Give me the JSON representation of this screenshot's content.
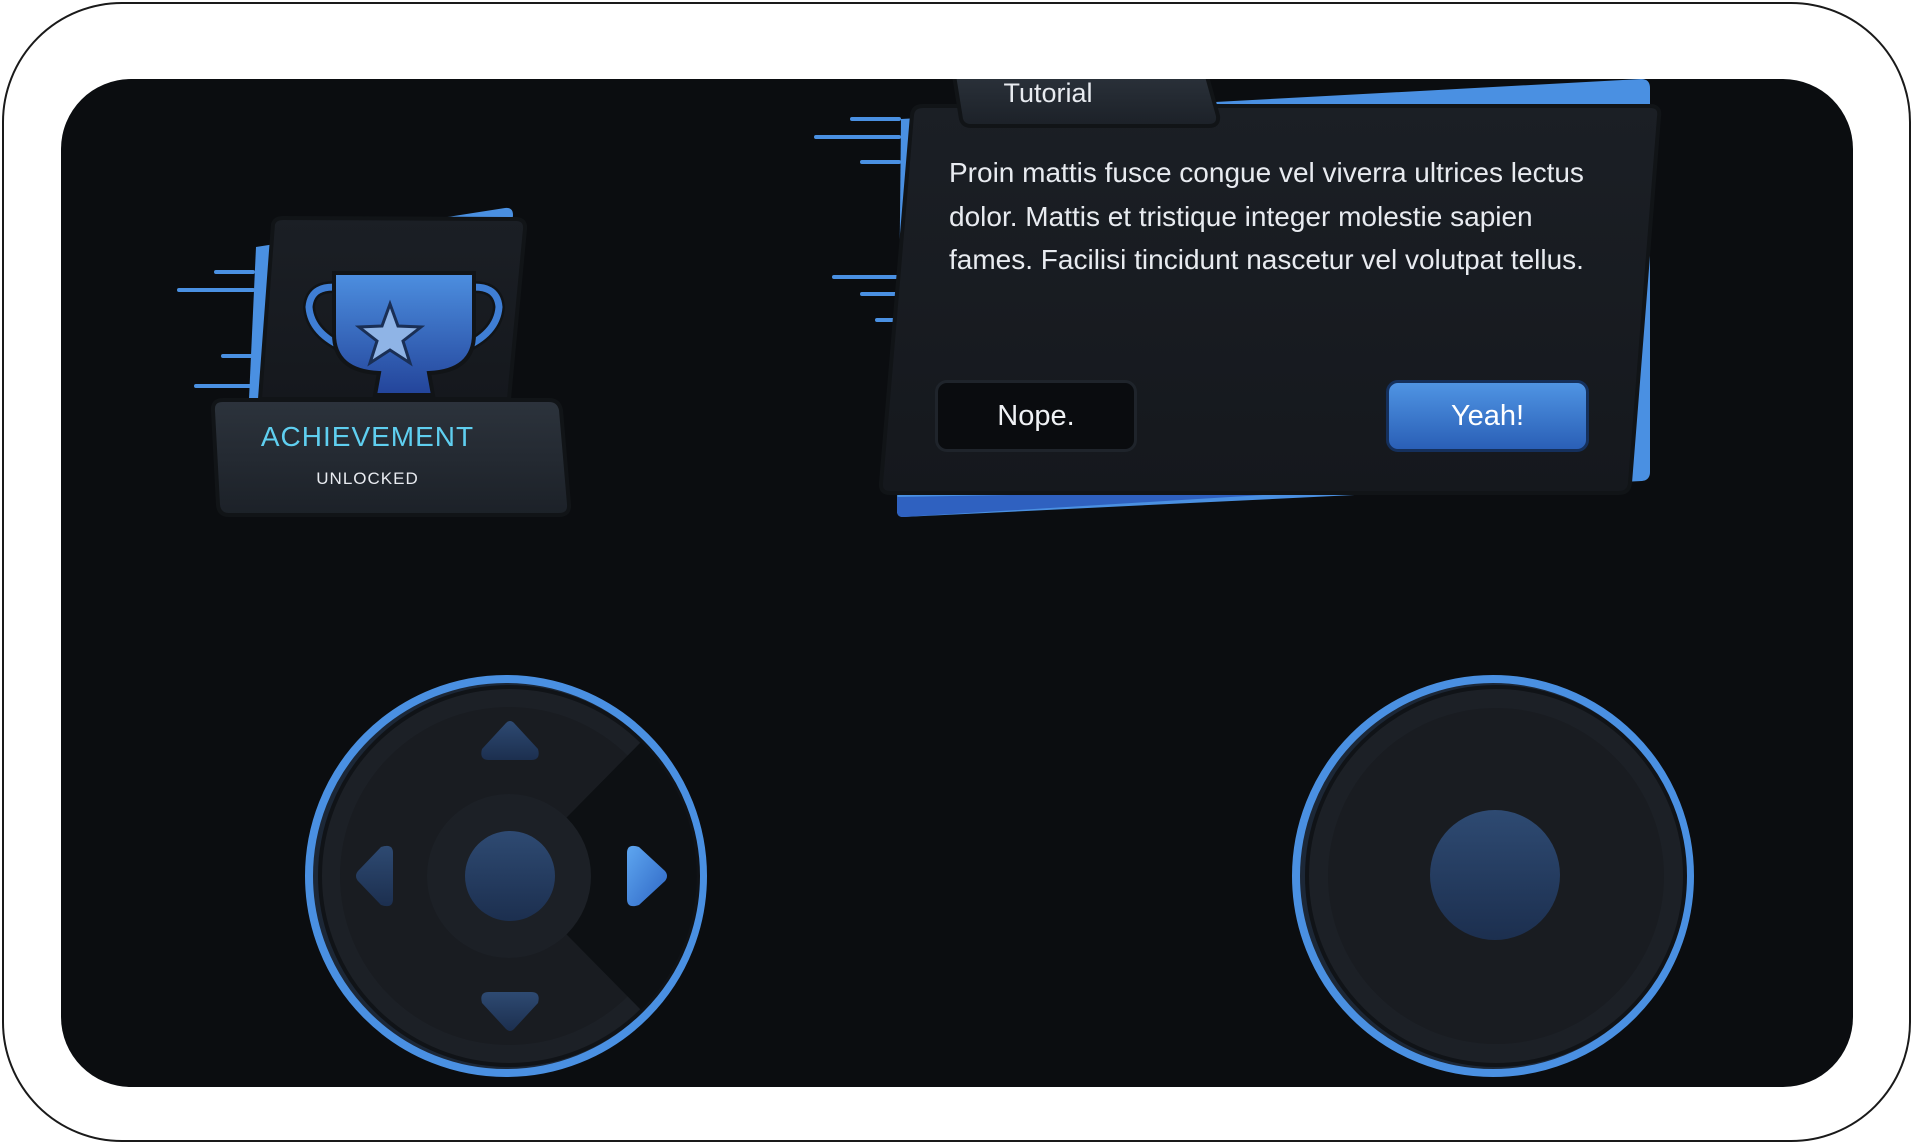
{
  "achievement": {
    "title": "ACHIEVEMENT",
    "subtitle": "UNLOCKED",
    "icon": "trophy-star-icon"
  },
  "tutorial": {
    "tab_label": "Tutorial",
    "body": "Proin mattis fusce congue vel viverra ultrices lectus dolor. Mattis et tristique integer molestie sapien fames. Facilisi tincidunt nascetur vel volutpat tellus.",
    "nope_label": "Nope.",
    "yeah_label": "Yeah!"
  },
  "controls": {
    "dpad": {
      "directions": [
        "up",
        "down",
        "left",
        "right"
      ],
      "active_direction": "right"
    },
    "joystick": {}
  },
  "colors": {
    "background": "#0b0d10",
    "panel": "#1a1e24",
    "accent_blue": "#4a90e2",
    "achievement_text": "#5fcff0",
    "frame": "#ffffff"
  }
}
